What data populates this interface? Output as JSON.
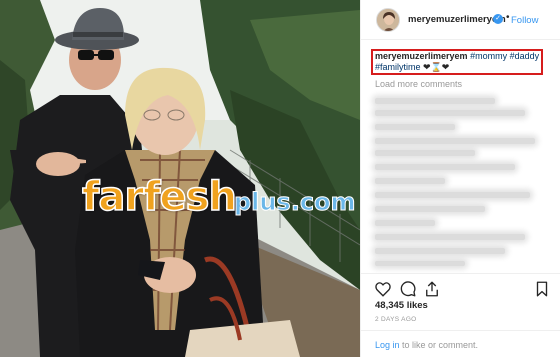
{
  "header": {
    "username": "meryemuzerlimeryem",
    "verified_icon": "verified-badge-icon",
    "separator": "•",
    "follow_label": "Follow"
  },
  "caption": {
    "username": "meryemuzerlimeryem",
    "hashtags": [
      "#mommy",
      "#daddy",
      "#familytime"
    ],
    "emoji": "❤⌛❤"
  },
  "load_more_label": "Load more comments",
  "actions": {
    "icons": [
      "heart-icon",
      "comment-icon",
      "share-icon",
      "bookmark-icon"
    ]
  },
  "likes_text": "48,345 likes",
  "time_ago": "2 DAYS AGO",
  "login": {
    "link_text": "Log in",
    "rest_text": " to like or comment."
  },
  "watermark": {
    "main": "farfesh",
    "sub": "plus.com"
  },
  "colors": {
    "link_blue": "#3897f0",
    "highlight_red": "#d61d1d",
    "watermark_orange": "#f0a21e",
    "watermark_blue": "#6bb7e8"
  }
}
